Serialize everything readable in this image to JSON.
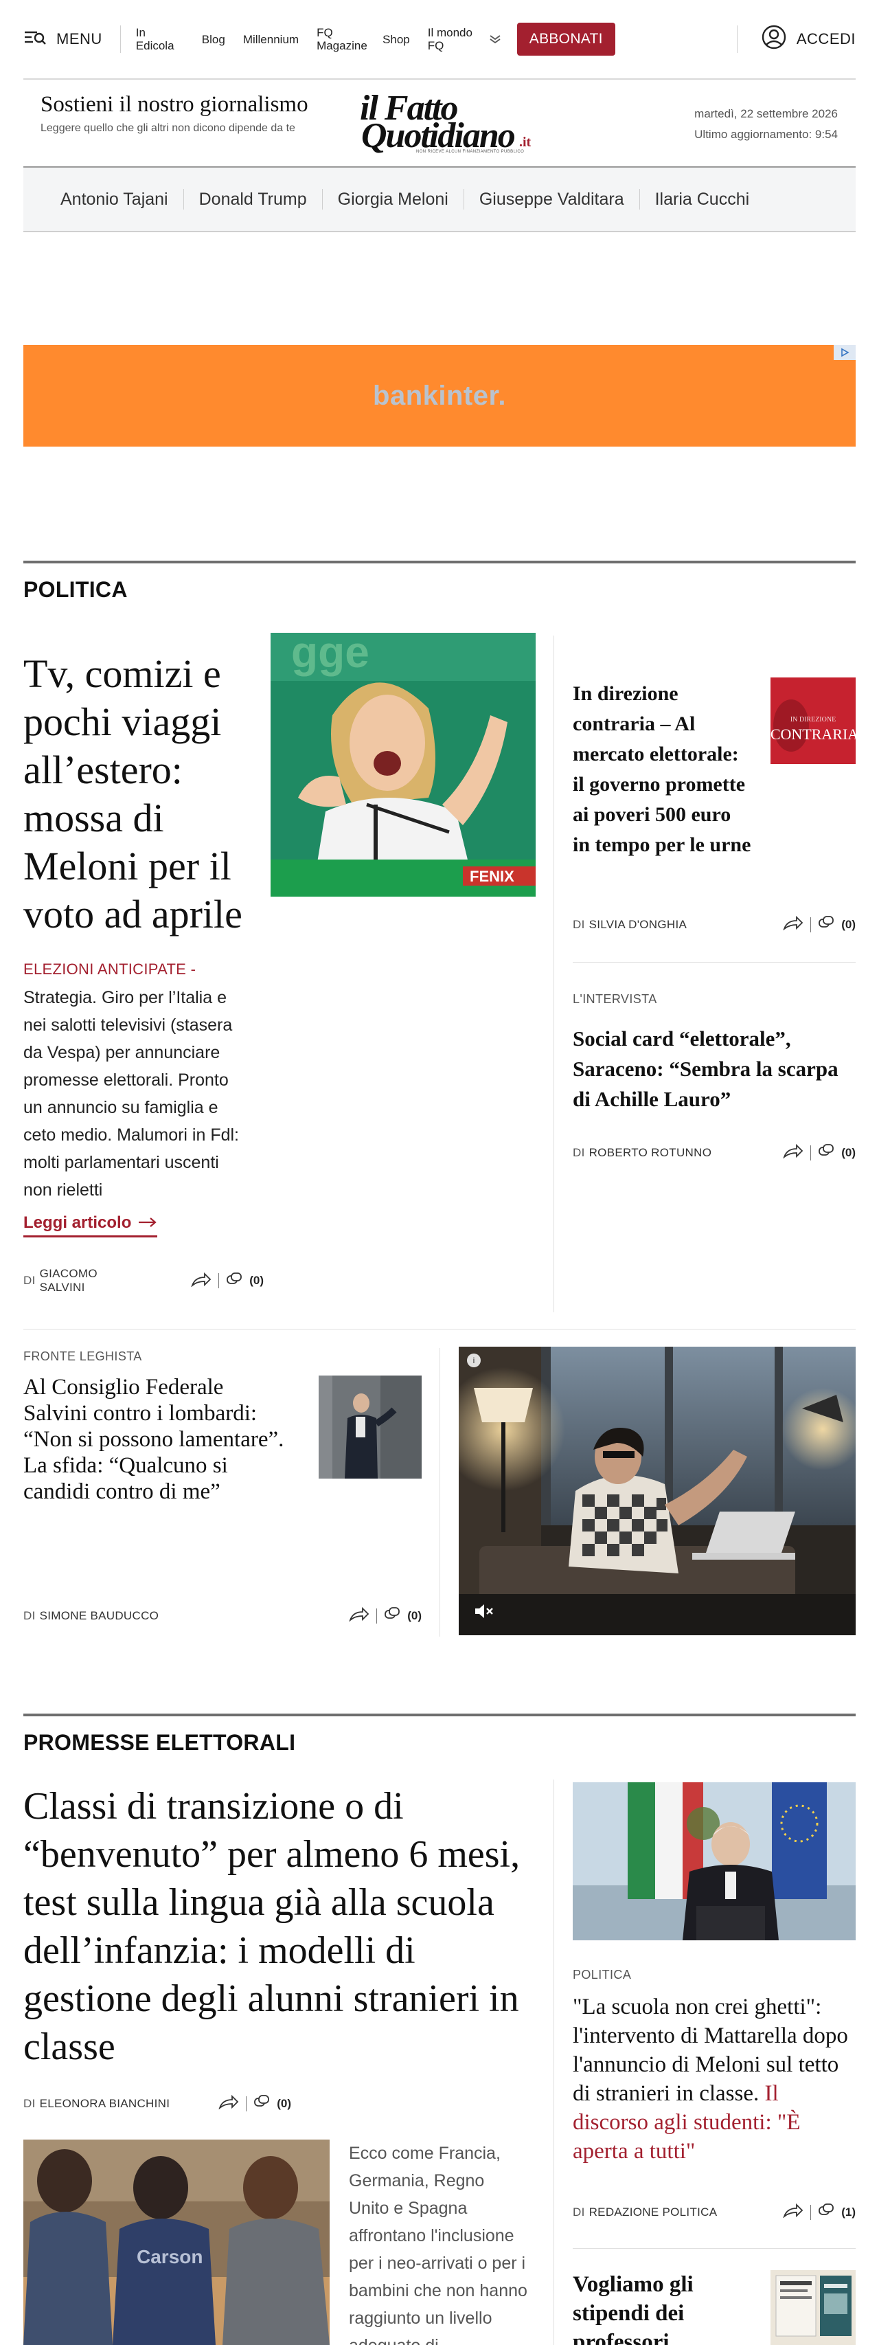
{
  "nav": {
    "menu_label": "MENU",
    "links": [
      "In Edicola",
      "Blog",
      "Millennium",
      "FQ Magazine",
      "Shop",
      "Il mondo FQ"
    ],
    "subscribe_label": "ABBONATI",
    "login_label": "ACCEDI"
  },
  "masthead": {
    "support_title": "Sostieni il nostro giornalismo",
    "support_subtitle": "Leggere quello che gli altri non dicono dipende da te",
    "logo_line1": "il Fatto",
    "logo_line2": "Quotidiano",
    "logo_suffix": ".it",
    "logo_tagline": "NON RICEVE ALCUN FINANZIAMENTO PUBBLICO",
    "date": "martedì, 22 settembre 2026",
    "updated": "Ultimo aggiornamento: 9:54"
  },
  "tags": [
    "Antonio Tajani",
    "Donald Trump",
    "Giorgia Meloni",
    "Giuseppe Valditara",
    "Ilaria Cucchi"
  ],
  "ad": {
    "brand": "bankinter."
  },
  "politica": {
    "section_title": "POLITICA",
    "main": {
      "title": "Tv, comizi e pochi viaggi all’estero: mossa di Meloni per il voto ad aprile",
      "kicker": "ELEZIONI ANTICIPATE -",
      "summary": "Strategia. Giro per l’Italia e nei salotti televisivi (stasera da Vespa) per annunciare promesse elettorali. Pronto un annuncio su famiglia e ceto medio. Malumori in Fdl: molti parlamentari uscenti non rieletti",
      "read_more": "Leggi articolo",
      "by": "DI",
      "author": "GIACOMO SALVINI",
      "comments": "(0)"
    },
    "right1": {
      "title": "In direzione contraria – Al mercato elettorale: il governo promette ai poveri 500 euro in tempo per le urne",
      "thumb_label": "CONTRARIA",
      "thumb_sub": "IN DIREZIONE",
      "by": "DI",
      "author": "SILVIA D'ONGHIA",
      "comments": "(0)"
    },
    "right2": {
      "kicker": "L'INTERVISTA",
      "title": "Social card “elettorale”, Saraceno: “Sembra la scarpa di Achille Lauro”",
      "by": "DI",
      "author": "ROBERTO ROTUNNO",
      "comments": "(0)"
    },
    "card1": {
      "kicker": "FRONTE LEGHISTA",
      "title": "Al Consiglio Federale Salvini contro i lombardi: “Non si possono lamentare”. La sfida: “Qualcuno si candidi contro di me”",
      "by": "DI",
      "author": "SIMONE BAUDUCCO",
      "comments": "(0)"
    }
  },
  "promesse": {
    "section_title": "PROMESSE ELETTORALI",
    "main": {
      "title": "Classi di transizione o di “benvenuto” per almeno 6 mesi, test sulla lingua già alla scuola dell’infanzia: i modelli di gestione degli alunni stranieri in classe",
      "by": "DI",
      "author": "ELEONORA BIANCHINI",
      "comments": "(0)",
      "summary": "Ecco come Francia, Germania, Regno Unito e Spagna affrontano l'inclusione per i neo-arrivati o per i bambini che non hanno raggiunto un livello adeguato di"
    },
    "right1": {
      "kicker": "POLITICA",
      "title": "\"La scuola non crei ghetti\": l'intervento di Mattarella dopo l'annuncio di Meloni sul tetto di stranieri in classe.",
      "title_red": "Il discorso agli studenti: \"È aperta a tutti\"",
      "by": "DI",
      "author": "REDAZIONE POLITICA",
      "comments": "(1)"
    },
    "right2": {
      "title": "Vogliamo gli stipendi dei professori adeguati"
    }
  },
  "colors": {
    "accent": "#a3202f",
    "ad_bg": "#ff8a2e",
    "tagbar_bg": "#f4f5f6"
  }
}
